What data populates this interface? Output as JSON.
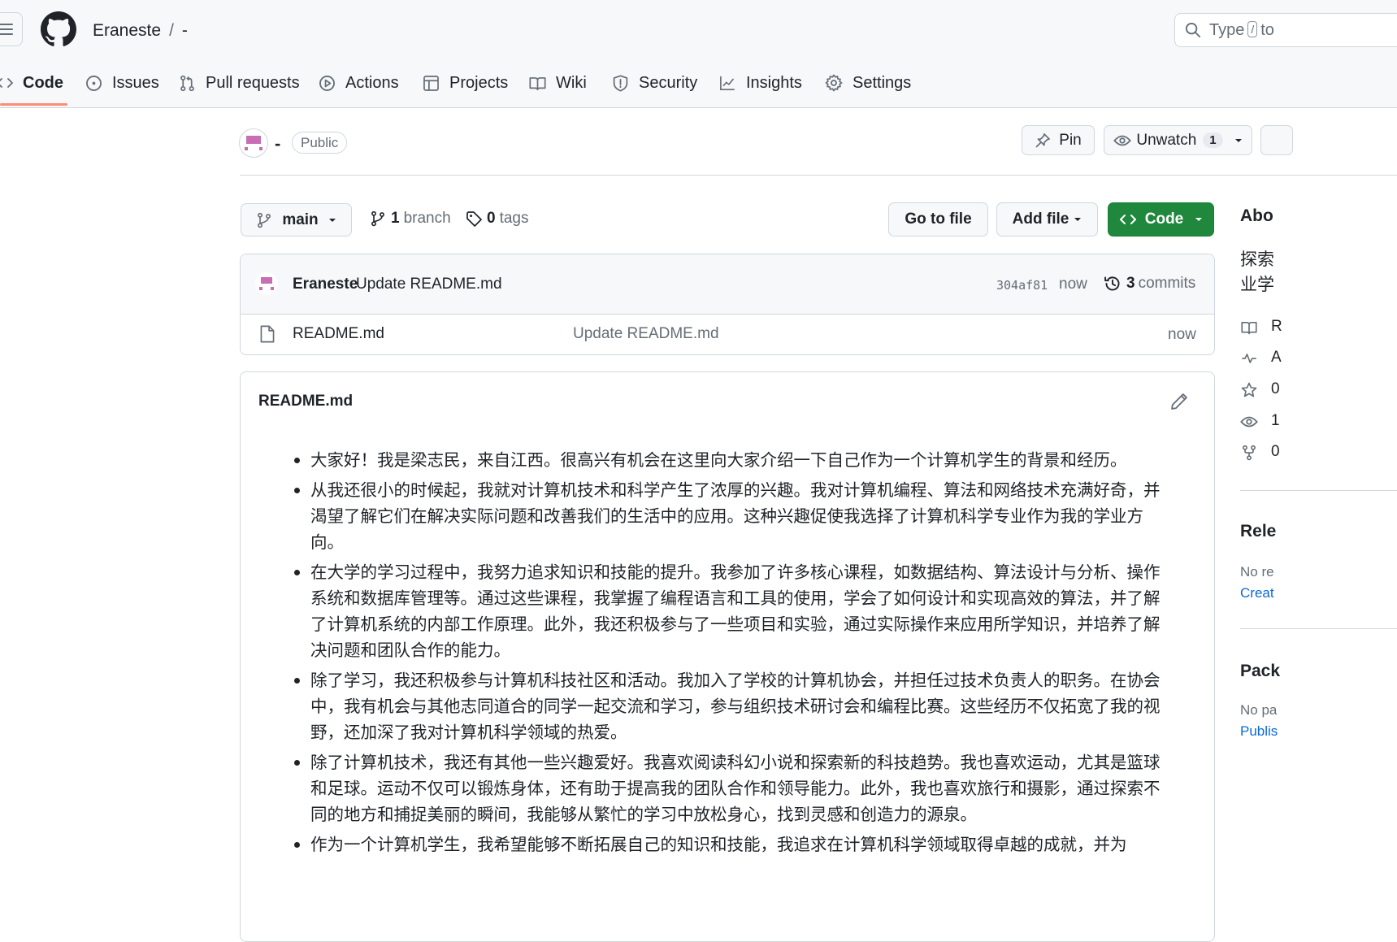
{
  "header": {
    "owner": "Eraneste",
    "separator": "/",
    "repo": "-",
    "search_placeholder_pre": "Type",
    "search_key": "/",
    "search_placeholder_post": "to"
  },
  "nav": {
    "tabs": [
      {
        "label": "Code",
        "icon": "code-icon",
        "active": true
      },
      {
        "label": "Issues",
        "icon": "issue-icon"
      },
      {
        "label": "Pull requests",
        "icon": "pull-request-icon"
      },
      {
        "label": "Actions",
        "icon": "play-icon"
      },
      {
        "label": "Projects",
        "icon": "table-icon"
      },
      {
        "label": "Wiki",
        "icon": "book-icon"
      },
      {
        "label": "Security",
        "icon": "shield-icon"
      },
      {
        "label": "Insights",
        "icon": "graph-icon"
      },
      {
        "label": "Settings",
        "icon": "gear-icon"
      }
    ]
  },
  "repo": {
    "name": "-",
    "visibility": "Public",
    "pin_label": "Pin",
    "watch_label": "Unwatch",
    "watch_count": "1"
  },
  "branch": {
    "current": "main",
    "branch_count": "1",
    "branch_label": "branch",
    "tag_count": "0",
    "tag_label": "tags",
    "goto_label": "Go to file",
    "addfile_label": "Add file",
    "code_label": "Code"
  },
  "commit": {
    "author": "Eraneste",
    "message": "Update README.md",
    "sha": "304af81",
    "time": "now",
    "count": "3",
    "count_label": "commits"
  },
  "files": [
    {
      "name": "README.md",
      "message": "Update README.md",
      "time": "now"
    }
  ],
  "readme": {
    "title": "README.md",
    "items": [
      "大家好！我是梁志民，来自江西。很高兴有机会在这里向大家介绍一下自己作为一个计算机学生的背景和经历。",
      "从我还很小的时候起，我就对计算机技术和科学产生了浓厚的兴趣。我对计算机编程、算法和网络技术充满好奇，并渴望了解它们在解决实际问题和改善我们的生活中的应用。这种兴趣促使我选择了计算机科学专业作为我的学业方向。",
      "在大学的学习过程中，我努力追求知识和技能的提升。我参加了许多核心课程，如数据结构、算法设计与分析、操作系统和数据库管理等。通过这些课程，我掌握了编程语言和工具的使用，学会了如何设计和实现高效的算法，并了解了计算机系统的内部工作原理。此外，我还积极参与了一些项目和实验，通过实际操作来应用所学知识，并培养了解决问题和团队合作的能力。",
      "除了学习，我还积极参与计算机科技社区和活动。我加入了学校的计算机协会，并担任过技术负责人的职务。在协会中，我有机会与其他志同道合的同学一起交流和学习，参与组织技术研讨会和编程比赛。这些经历不仅拓宽了我的视野，还加深了我对计算机科学领域的热爱。",
      "除了计算机技术，我还有其他一些兴趣爱好。我喜欢阅读科幻小说和探索新的科技趋势。我也喜欢运动，尤其是篮球和足球。运动不仅可以锻炼身体，还有助于提高我的团队合作和领导能力。此外，我也喜欢旅行和摄影，通过探索不同的地方和捕捉美丽的瞬间，我能够从繁忙的学习中放松身心，找到灵感和创造力的源泉。",
      "作为一个计算机学生，我希望能够不断拓展自己的知识和技能，我追求在计算机科学领域取得卓越的成就，并为"
    ]
  },
  "sidebar": {
    "about_title": "Abo",
    "about_desc_line1": "探索",
    "about_desc_line2": "业学",
    "stats": [
      {
        "icon": "book-icon",
        "text": "R"
      },
      {
        "icon": "pulse-icon",
        "text": "A"
      },
      {
        "icon": "star-icon",
        "text": "0"
      },
      {
        "icon": "eye-icon",
        "text": "1"
      },
      {
        "icon": "fork-icon",
        "text": "0"
      }
    ],
    "releases_title": "Rele",
    "releases_empty": "No re",
    "releases_link": "Creat",
    "packages_title": "Pack",
    "packages_empty": "No pa",
    "packages_link": "Publis"
  },
  "colors": {
    "primary_button": "#1f883d",
    "nav_underline": "#fd8c73",
    "link": "#0969da",
    "identicon": "#c86eb4"
  }
}
